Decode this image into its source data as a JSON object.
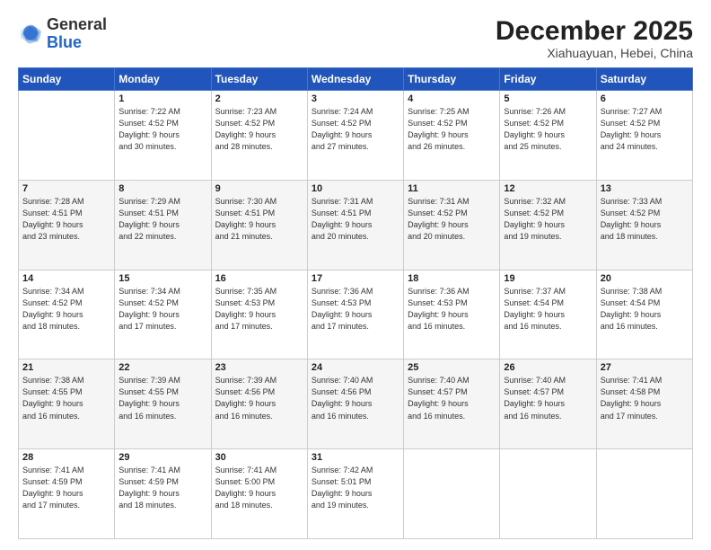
{
  "logo": {
    "general": "General",
    "blue": "Blue"
  },
  "header": {
    "month": "December 2025",
    "location": "Xiahuayuan, Hebei, China"
  },
  "days_of_week": [
    "Sunday",
    "Monday",
    "Tuesday",
    "Wednesday",
    "Thursday",
    "Friday",
    "Saturday"
  ],
  "weeks": [
    [
      {
        "day": "",
        "sunrise": "",
        "sunset": "",
        "daylight": ""
      },
      {
        "day": "1",
        "sunrise": "Sunrise: 7:22 AM",
        "sunset": "Sunset: 4:52 PM",
        "daylight": "Daylight: 9 hours and 30 minutes."
      },
      {
        "day": "2",
        "sunrise": "Sunrise: 7:23 AM",
        "sunset": "Sunset: 4:52 PM",
        "daylight": "Daylight: 9 hours and 28 minutes."
      },
      {
        "day": "3",
        "sunrise": "Sunrise: 7:24 AM",
        "sunset": "Sunset: 4:52 PM",
        "daylight": "Daylight: 9 hours and 27 minutes."
      },
      {
        "day": "4",
        "sunrise": "Sunrise: 7:25 AM",
        "sunset": "Sunset: 4:52 PM",
        "daylight": "Daylight: 9 hours and 26 minutes."
      },
      {
        "day": "5",
        "sunrise": "Sunrise: 7:26 AM",
        "sunset": "Sunset: 4:52 PM",
        "daylight": "Daylight: 9 hours and 25 minutes."
      },
      {
        "day": "6",
        "sunrise": "Sunrise: 7:27 AM",
        "sunset": "Sunset: 4:52 PM",
        "daylight": "Daylight: 9 hours and 24 minutes."
      }
    ],
    [
      {
        "day": "7",
        "sunrise": "Sunrise: 7:28 AM",
        "sunset": "Sunset: 4:51 PM",
        "daylight": "Daylight: 9 hours and 23 minutes."
      },
      {
        "day": "8",
        "sunrise": "Sunrise: 7:29 AM",
        "sunset": "Sunset: 4:51 PM",
        "daylight": "Daylight: 9 hours and 22 minutes."
      },
      {
        "day": "9",
        "sunrise": "Sunrise: 7:30 AM",
        "sunset": "Sunset: 4:51 PM",
        "daylight": "Daylight: 9 hours and 21 minutes."
      },
      {
        "day": "10",
        "sunrise": "Sunrise: 7:31 AM",
        "sunset": "Sunset: 4:51 PM",
        "daylight": "Daylight: 9 hours and 20 minutes."
      },
      {
        "day": "11",
        "sunrise": "Sunrise: 7:31 AM",
        "sunset": "Sunset: 4:52 PM",
        "daylight": "Daylight: 9 hours and 20 minutes."
      },
      {
        "day": "12",
        "sunrise": "Sunrise: 7:32 AM",
        "sunset": "Sunset: 4:52 PM",
        "daylight": "Daylight: 9 hours and 19 minutes."
      },
      {
        "day": "13",
        "sunrise": "Sunrise: 7:33 AM",
        "sunset": "Sunset: 4:52 PM",
        "daylight": "Daylight: 9 hours and 18 minutes."
      }
    ],
    [
      {
        "day": "14",
        "sunrise": "Sunrise: 7:34 AM",
        "sunset": "Sunset: 4:52 PM",
        "daylight": "Daylight: 9 hours and 18 minutes."
      },
      {
        "day": "15",
        "sunrise": "Sunrise: 7:34 AM",
        "sunset": "Sunset: 4:52 PM",
        "daylight": "Daylight: 9 hours and 17 minutes."
      },
      {
        "day": "16",
        "sunrise": "Sunrise: 7:35 AM",
        "sunset": "Sunset: 4:53 PM",
        "daylight": "Daylight: 9 hours and 17 minutes."
      },
      {
        "day": "17",
        "sunrise": "Sunrise: 7:36 AM",
        "sunset": "Sunset: 4:53 PM",
        "daylight": "Daylight: 9 hours and 17 minutes."
      },
      {
        "day": "18",
        "sunrise": "Sunrise: 7:36 AM",
        "sunset": "Sunset: 4:53 PM",
        "daylight": "Daylight: 9 hours and 16 minutes."
      },
      {
        "day": "19",
        "sunrise": "Sunrise: 7:37 AM",
        "sunset": "Sunset: 4:54 PM",
        "daylight": "Daylight: 9 hours and 16 minutes."
      },
      {
        "day": "20",
        "sunrise": "Sunrise: 7:38 AM",
        "sunset": "Sunset: 4:54 PM",
        "daylight": "Daylight: 9 hours and 16 minutes."
      }
    ],
    [
      {
        "day": "21",
        "sunrise": "Sunrise: 7:38 AM",
        "sunset": "Sunset: 4:55 PM",
        "daylight": "Daylight: 9 hours and 16 minutes."
      },
      {
        "day": "22",
        "sunrise": "Sunrise: 7:39 AM",
        "sunset": "Sunset: 4:55 PM",
        "daylight": "Daylight: 9 hours and 16 minutes."
      },
      {
        "day": "23",
        "sunrise": "Sunrise: 7:39 AM",
        "sunset": "Sunset: 4:56 PM",
        "daylight": "Daylight: 9 hours and 16 minutes."
      },
      {
        "day": "24",
        "sunrise": "Sunrise: 7:40 AM",
        "sunset": "Sunset: 4:56 PM",
        "daylight": "Daylight: 9 hours and 16 minutes."
      },
      {
        "day": "25",
        "sunrise": "Sunrise: 7:40 AM",
        "sunset": "Sunset: 4:57 PM",
        "daylight": "Daylight: 9 hours and 16 minutes."
      },
      {
        "day": "26",
        "sunrise": "Sunrise: 7:40 AM",
        "sunset": "Sunset: 4:57 PM",
        "daylight": "Daylight: 9 hours and 16 minutes."
      },
      {
        "day": "27",
        "sunrise": "Sunrise: 7:41 AM",
        "sunset": "Sunset: 4:58 PM",
        "daylight": "Daylight: 9 hours and 17 minutes."
      }
    ],
    [
      {
        "day": "28",
        "sunrise": "Sunrise: 7:41 AM",
        "sunset": "Sunset: 4:59 PM",
        "daylight": "Daylight: 9 hours and 17 minutes."
      },
      {
        "day": "29",
        "sunrise": "Sunrise: 7:41 AM",
        "sunset": "Sunset: 4:59 PM",
        "daylight": "Daylight: 9 hours and 18 minutes."
      },
      {
        "day": "30",
        "sunrise": "Sunrise: 7:41 AM",
        "sunset": "Sunset: 5:00 PM",
        "daylight": "Daylight: 9 hours and 18 minutes."
      },
      {
        "day": "31",
        "sunrise": "Sunrise: 7:42 AM",
        "sunset": "Sunset: 5:01 PM",
        "daylight": "Daylight: 9 hours and 19 minutes."
      },
      {
        "day": "",
        "sunrise": "",
        "sunset": "",
        "daylight": ""
      },
      {
        "day": "",
        "sunrise": "",
        "sunset": "",
        "daylight": ""
      },
      {
        "day": "",
        "sunrise": "",
        "sunset": "",
        "daylight": ""
      }
    ]
  ]
}
